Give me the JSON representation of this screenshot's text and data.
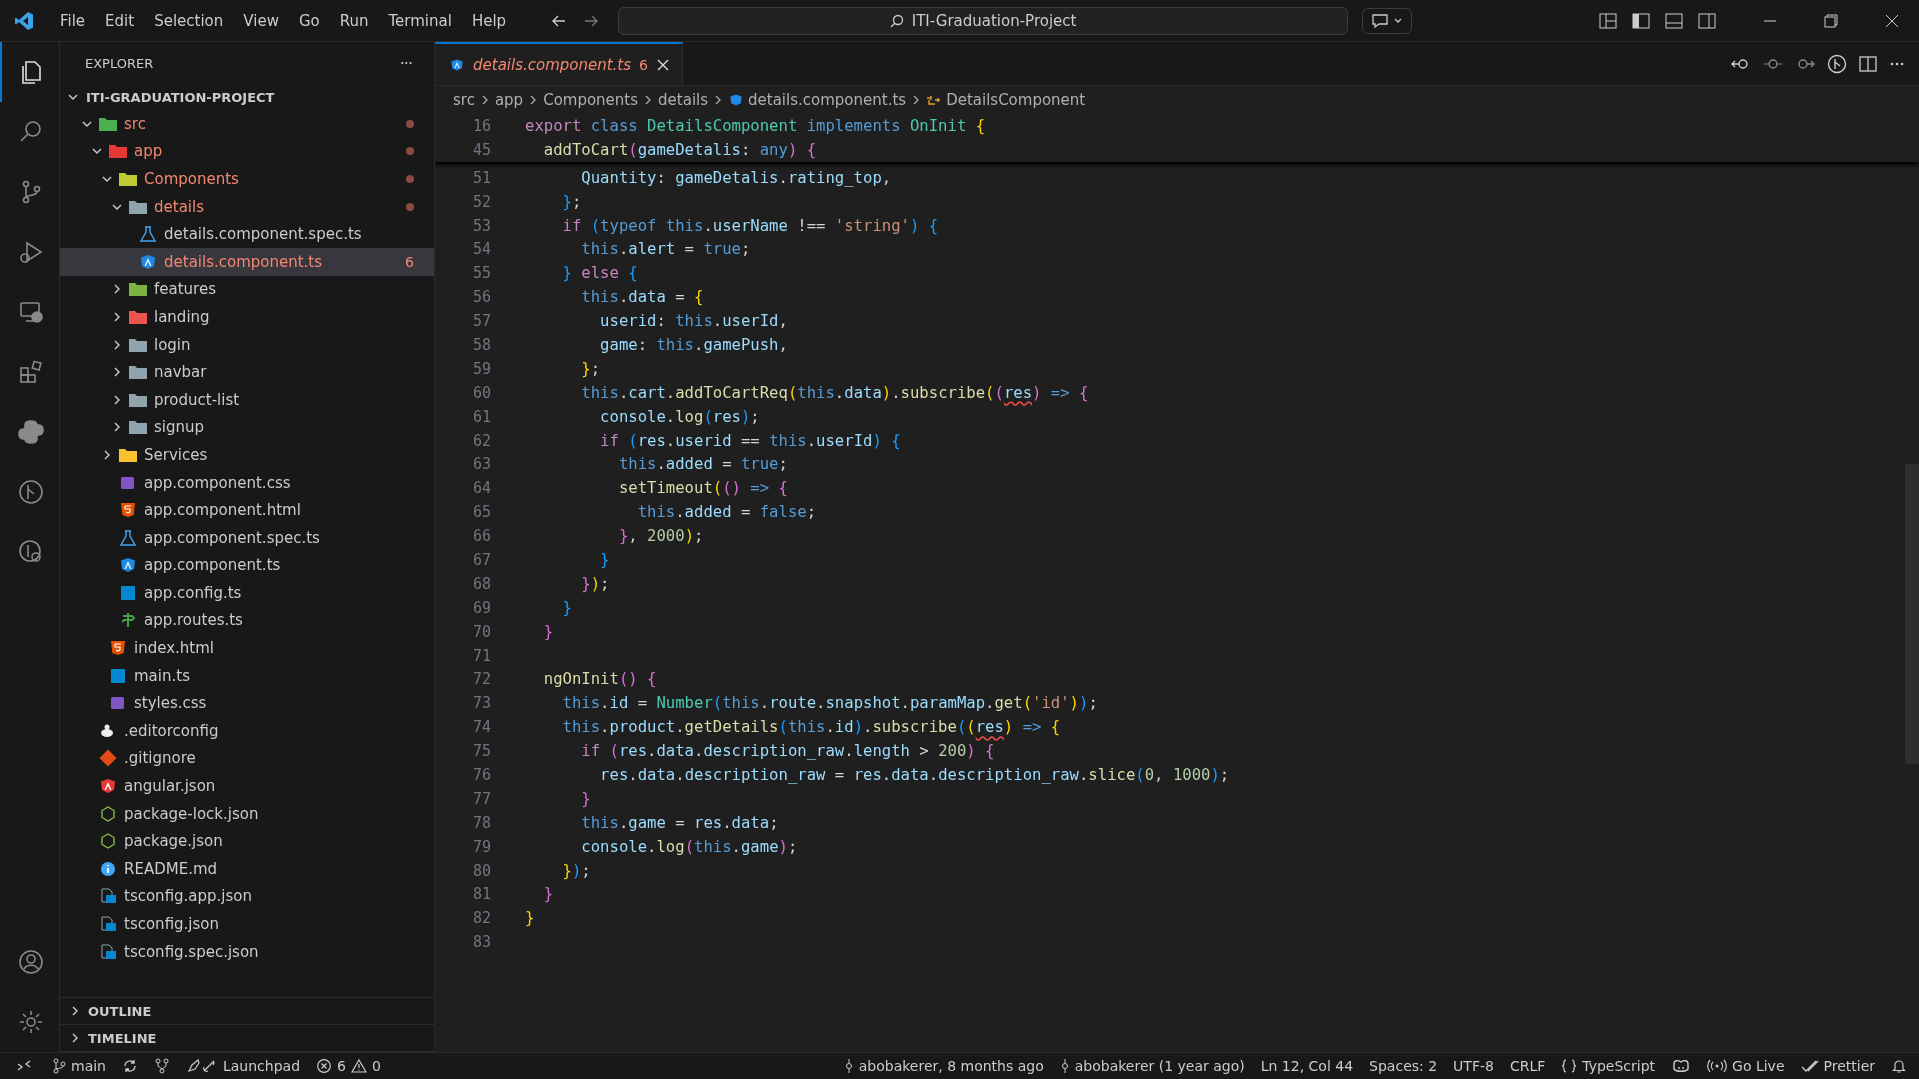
{
  "title_bar": {
    "menu": [
      "File",
      "Edit",
      "Selection",
      "View",
      "Go",
      "Run",
      "Terminal",
      "Help"
    ],
    "command_center": "ITI-Graduation-Project"
  },
  "activity_bar": {
    "top": [
      {
        "kind": "files",
        "selected": true
      },
      {
        "kind": "search",
        "selected": false
      },
      {
        "kind": "branch",
        "selected": false
      },
      {
        "kind": "debug",
        "selected": false
      },
      {
        "kind": "remote",
        "selected": false
      },
      {
        "kind": "extensions",
        "selected": false
      },
      {
        "kind": "python",
        "selected": false
      },
      {
        "kind": "graph",
        "selected": false
      },
      {
        "kind": "history",
        "selected": false
      }
    ],
    "bottom": [
      {
        "kind": "account"
      },
      {
        "kind": "settings"
      }
    ]
  },
  "sidebar": {
    "title": "EXPLORER",
    "more": "···",
    "root": "ITI-GRADUATION-PROJECT",
    "tree": [
      {
        "name": "src",
        "kind": "folder",
        "color": "#4caf50",
        "expanded": true,
        "has_errors": true,
        "selected": false,
        "children": [
          {
            "name": "app",
            "kind": "folder",
            "color": "#e53935",
            "expanded": true,
            "has_errors": true,
            "selected": false,
            "children": [
              {
                "name": "Components",
                "kind": "folder",
                "color": "#c0ca33",
                "expanded": true,
                "has_errors": true,
                "selected": false,
                "children": [
                  {
                    "name": "details",
                    "kind": "folder",
                    "color": "#90a4ae",
                    "expanded": true,
                    "has_errors": true,
                    "selected": false,
                    "children": [
                      {
                        "name": "details.component.spec.ts",
                        "kind": "spec",
                        "has_errors": false,
                        "selected": false
                      },
                      {
                        "name": "details.component.ts",
                        "kind": "angular",
                        "has_errors": true,
                        "badge": "6",
                        "selected": true
                      }
                    ]
                  },
                  {
                    "name": "features",
                    "kind": "folder",
                    "color": "#7cb342",
                    "expanded": false,
                    "has_errors": false,
                    "selected": false
                  },
                  {
                    "name": "landing",
                    "kind": "folder",
                    "color": "#ef5350",
                    "expanded": false,
                    "has_errors": false,
                    "selected": false
                  },
                  {
                    "name": "login",
                    "kind": "folder",
                    "color": "#90a4ae",
                    "expanded": false,
                    "has_errors": false,
                    "selected": false
                  },
                  {
                    "name": "navbar",
                    "kind": "folder",
                    "color": "#90a4ae",
                    "expanded": false,
                    "has_errors": false,
                    "selected": false
                  },
                  {
                    "name": "product-list",
                    "kind": "folder",
                    "color": "#90a4ae",
                    "expanded": false,
                    "has_errors": false,
                    "selected": false
                  },
                  {
                    "name": "signup",
                    "kind": "folder",
                    "color": "#90a4ae",
                    "expanded": false,
                    "has_errors": false,
                    "selected": false
                  }
                ]
              },
              {
                "name": "Services",
                "kind": "folder",
                "color": "#fbc02d",
                "expanded": false,
                "has_errors": false,
                "selected": false
              },
              {
                "name": "app.component.css",
                "kind": "css",
                "has_errors": false,
                "selected": false
              },
              {
                "name": "app.component.html",
                "kind": "html",
                "has_errors": false,
                "selected": false
              },
              {
                "name": "app.component.spec.ts",
                "kind": "spec",
                "has_errors": false,
                "selected": false
              },
              {
                "name": "app.component.ts",
                "kind": "angular",
                "has_errors": false,
                "selected": false
              },
              {
                "name": "app.config.ts",
                "kind": "ts",
                "has_errors": false,
                "selected": false
              },
              {
                "name": "app.routes.ts",
                "kind": "routes",
                "has_errors": false,
                "selected": false
              }
            ]
          },
          {
            "name": "index.html",
            "kind": "html",
            "has_errors": false,
            "selected": false
          },
          {
            "name": "main.ts",
            "kind": "ts",
            "has_errors": false,
            "selected": false
          },
          {
            "name": "styles.css",
            "kind": "css",
            "has_errors": false,
            "selected": false
          }
        ]
      },
      {
        "name": ".editorconfig",
        "kind": "config",
        "has_errors": false,
        "selected": false
      },
      {
        "name": ".gitignore",
        "kind": "git",
        "has_errors": false,
        "selected": false
      },
      {
        "name": "angular.json",
        "kind": "angular-json",
        "has_errors": false,
        "selected": false
      },
      {
        "name": "package-lock.json",
        "kind": "npm",
        "has_errors": false,
        "selected": false
      },
      {
        "name": "package.json",
        "kind": "npm",
        "has_errors": false,
        "selected": false
      },
      {
        "name": "README.md",
        "kind": "info",
        "has_errors": false,
        "selected": false
      },
      {
        "name": "tsconfig.app.json",
        "kind": "tsconfig",
        "has_errors": false,
        "selected": false
      },
      {
        "name": "tsconfig.json",
        "kind": "tsconfig",
        "has_errors": false,
        "selected": false
      },
      {
        "name": "tsconfig.spec.json",
        "kind": "tsconfig",
        "has_errors": false,
        "selected": false
      }
    ],
    "sections": [
      "OUTLINE",
      "TIMELINE"
    ]
  },
  "tabs": [
    {
      "label": "details.component.ts",
      "badge": "6",
      "selected": true
    }
  ],
  "breadcrumbs": [
    "src",
    "app",
    "Components",
    "details",
    "details.component.ts",
    "DetailsComponent"
  ],
  "sticky_lines": [
    {
      "number": "16",
      "tokens": [
        {
          "kind": "keyword",
          "text": "export "
        },
        {
          "kind": "storage",
          "text": "class "
        },
        {
          "kind": "type",
          "text": "DetailsComponent "
        },
        {
          "kind": "storage",
          "text": "implements "
        },
        {
          "kind": "type",
          "text": "OnInit "
        },
        {
          "kind": "bracket1",
          "text": "{"
        }
      ]
    },
    {
      "number": "45",
      "tokens": [
        {
          "kind": "function",
          "text": "  addToCart"
        },
        {
          "kind": "bracket2",
          "text": "("
        },
        {
          "kind": "variable",
          "text": "gameDetalis"
        },
        {
          "kind": "plain",
          "text": ": "
        },
        {
          "kind": "storage",
          "text": "any"
        },
        {
          "kind": "bracket2",
          "text": ")"
        },
        {
          "kind": "bracket2",
          "text": " {"
        }
      ]
    }
  ],
  "lines": [
    {
      "number": "51",
      "tokens": [
        {
          "kind": "variable",
          "text": "      Quantity"
        },
        {
          "kind": "plain",
          "text": ": "
        },
        {
          "kind": "variable",
          "text": "gameDetalis"
        },
        {
          "kind": "plain",
          "text": "."
        },
        {
          "kind": "variable",
          "text": "rating_top"
        },
        {
          "kind": "plain",
          "text": ","
        }
      ]
    },
    {
      "number": "52",
      "tokens": [
        {
          "kind": "bracket3",
          "text": "    }"
        },
        {
          "kind": "plain",
          "text": ";"
        }
      ]
    },
    {
      "number": "53",
      "tokens": [
        {
          "kind": "keyword",
          "text": "    if "
        },
        {
          "kind": "bracket3",
          "text": "("
        },
        {
          "kind": "storage",
          "text": "typeof this"
        },
        {
          "kind": "plain",
          "text": "."
        },
        {
          "kind": "variable",
          "text": "userName"
        },
        {
          "kind": "plain",
          "text": " !== "
        },
        {
          "kind": "string",
          "text": "'string'"
        },
        {
          "kind": "bracket3",
          "text": ")"
        },
        {
          "kind": "bracket3",
          "text": " {"
        }
      ]
    },
    {
      "number": "54",
      "tokens": [
        {
          "kind": "storage",
          "text": "      this"
        },
        {
          "kind": "plain",
          "text": "."
        },
        {
          "kind": "variable",
          "text": "alert"
        },
        {
          "kind": "plain",
          "text": " = "
        },
        {
          "kind": "storage",
          "text": "true"
        },
        {
          "kind": "plain",
          "text": ";"
        }
      ]
    },
    {
      "number": "55",
      "tokens": [
        {
          "kind": "bracket3",
          "text": "    }"
        },
        {
          "kind": "keyword",
          "text": " else "
        },
        {
          "kind": "bracket3",
          "text": "{"
        }
      ]
    },
    {
      "number": "56",
      "tokens": [
        {
          "kind": "storage",
          "text": "      this"
        },
        {
          "kind": "plain",
          "text": "."
        },
        {
          "kind": "variable",
          "text": "data"
        },
        {
          "kind": "plain",
          "text": " = "
        },
        {
          "kind": "bracket1",
          "text": "{"
        }
      ]
    },
    {
      "number": "57",
      "tokens": [
        {
          "kind": "variable",
          "text": "        userid"
        },
        {
          "kind": "plain",
          "text": ": "
        },
        {
          "kind": "storage",
          "text": "this"
        },
        {
          "kind": "plain",
          "text": "."
        },
        {
          "kind": "variable",
          "text": "userId"
        },
        {
          "kind": "plain",
          "text": ","
        }
      ]
    },
    {
      "number": "58",
      "tokens": [
        {
          "kind": "variable",
          "text": "        game"
        },
        {
          "kind": "plain",
          "text": ": "
        },
        {
          "kind": "storage",
          "text": "this"
        },
        {
          "kind": "plain",
          "text": "."
        },
        {
          "kind": "variable",
          "text": "gamePush"
        },
        {
          "kind": "plain",
          "text": ","
        }
      ]
    },
    {
      "number": "59",
      "tokens": [
        {
          "kind": "bracket1",
          "text": "      }"
        },
        {
          "kind": "plain",
          "text": ";"
        }
      ]
    },
    {
      "number": "60",
      "tokens": [
        {
          "kind": "storage",
          "text": "      this"
        },
        {
          "kind": "plain",
          "text": "."
        },
        {
          "kind": "variable",
          "text": "cart"
        },
        {
          "kind": "plain",
          "text": "."
        },
        {
          "kind": "function",
          "text": "addToCartReq"
        },
        {
          "kind": "bracket1",
          "text": "("
        },
        {
          "kind": "storage",
          "text": "this"
        },
        {
          "kind": "plain",
          "text": "."
        },
        {
          "kind": "variable",
          "text": "data"
        },
        {
          "kind": "bracket1",
          "text": ")"
        },
        {
          "kind": "plain",
          "text": "."
        },
        {
          "kind": "function",
          "text": "subscribe"
        },
        {
          "kind": "bracket1",
          "text": "("
        },
        {
          "kind": "bracket2",
          "text": "("
        },
        {
          "kind": "error",
          "text": "res"
        },
        {
          "kind": "bracket2",
          "text": ")"
        },
        {
          "kind": "storage",
          "text": " => "
        },
        {
          "kind": "bracket2",
          "text": "{"
        }
      ]
    },
    {
      "number": "61",
      "tokens": [
        {
          "kind": "variable",
          "text": "        console"
        },
        {
          "kind": "plain",
          "text": "."
        },
        {
          "kind": "function",
          "text": "log"
        },
        {
          "kind": "bracket3",
          "text": "("
        },
        {
          "kind": "variable",
          "text": "res"
        },
        {
          "kind": "bracket3",
          "text": ")"
        },
        {
          "kind": "plain",
          "text": ";"
        }
      ]
    },
    {
      "number": "62",
      "tokens": [
        {
          "kind": "keyword",
          "text": "        if "
        },
        {
          "kind": "bracket3",
          "text": "("
        },
        {
          "kind": "variable",
          "text": "res"
        },
        {
          "kind": "plain",
          "text": "."
        },
        {
          "kind": "variable",
          "text": "userid"
        },
        {
          "kind": "plain",
          "text": " == "
        },
        {
          "kind": "storage",
          "text": "this"
        },
        {
          "kind": "plain",
          "text": "."
        },
        {
          "kind": "variable",
          "text": "userId"
        },
        {
          "kind": "bracket3",
          "text": ")"
        },
        {
          "kind": "bracket3",
          "text": " {"
        }
      ]
    },
    {
      "number": "63",
      "tokens": [
        {
          "kind": "storage",
          "text": "          this"
        },
        {
          "kind": "plain",
          "text": "."
        },
        {
          "kind": "variable",
          "text": "added"
        },
        {
          "kind": "plain",
          "text": " = "
        },
        {
          "kind": "storage",
          "text": "true"
        },
        {
          "kind": "plain",
          "text": ";"
        }
      ]
    },
    {
      "number": "64",
      "tokens": [
        {
          "kind": "function",
          "text": "          setTimeout"
        },
        {
          "kind": "bracket1",
          "text": "("
        },
        {
          "kind": "bracket2",
          "text": "()"
        },
        {
          "kind": "storage",
          "text": " => "
        },
        {
          "kind": "bracket2",
          "text": "{"
        }
      ]
    },
    {
      "number": "65",
      "tokens": [
        {
          "kind": "storage",
          "text": "            this"
        },
        {
          "kind": "plain",
          "text": "."
        },
        {
          "kind": "variable",
          "text": "added"
        },
        {
          "kind": "plain",
          "text": " = "
        },
        {
          "kind": "storage",
          "text": "false"
        },
        {
          "kind": "plain",
          "text": ";"
        }
      ]
    },
    {
      "number": "66",
      "tokens": [
        {
          "kind": "bracket2",
          "text": "          }"
        },
        {
          "kind": "plain",
          "text": ", "
        },
        {
          "kind": "number",
          "text": "2000"
        },
        {
          "kind": "bracket1",
          "text": ")"
        },
        {
          "kind": "plain",
          "text": ";"
        }
      ]
    },
    {
      "number": "67",
      "tokens": [
        {
          "kind": "bracket3",
          "text": "        }"
        }
      ]
    },
    {
      "number": "68",
      "tokens": [
        {
          "kind": "bracket2",
          "text": "      }"
        },
        {
          "kind": "bracket1",
          "text": ")"
        },
        {
          "kind": "plain",
          "text": ";"
        }
      ]
    },
    {
      "number": "69",
      "tokens": [
        {
          "kind": "bracket3",
          "text": "    }"
        }
      ]
    },
    {
      "number": "70",
      "tokens": [
        {
          "kind": "bracket2",
          "text": "  }"
        }
      ]
    },
    {
      "number": "71"
    },
    {
      "number": "72",
      "tokens": [
        {
          "kind": "function",
          "text": "  ngOnInit"
        },
        {
          "kind": "bracket2",
          "text": "()"
        },
        {
          "kind": "bracket2",
          "text": " {"
        }
      ]
    },
    {
      "number": "73",
      "tokens": [
        {
          "kind": "storage",
          "text": "    this"
        },
        {
          "kind": "plain",
          "text": "."
        },
        {
          "kind": "variable",
          "text": "id"
        },
        {
          "kind": "plain",
          "text": " = "
        },
        {
          "kind": "type",
          "text": "Number"
        },
        {
          "kind": "bracket3",
          "text": "("
        },
        {
          "kind": "storage",
          "text": "this"
        },
        {
          "kind": "plain",
          "text": "."
        },
        {
          "kind": "variable",
          "text": "route"
        },
        {
          "kind": "plain",
          "text": "."
        },
        {
          "kind": "variable",
          "text": "snapshot"
        },
        {
          "kind": "plain",
          "text": "."
        },
        {
          "kind": "variable",
          "text": "paramMap"
        },
        {
          "kind": "plain",
          "text": "."
        },
        {
          "kind": "function",
          "text": "get"
        },
        {
          "kind": "bracket1",
          "text": "("
        },
        {
          "kind": "string",
          "text": "'id'"
        },
        {
          "kind": "bracket1",
          "text": ")"
        },
        {
          "kind": "bracket3",
          "text": ")"
        },
        {
          "kind": "plain",
          "text": ";"
        }
      ]
    },
    {
      "number": "74",
      "tokens": [
        {
          "kind": "storage",
          "text": "    this"
        },
        {
          "kind": "plain",
          "text": "."
        },
        {
          "kind": "variable",
          "text": "product"
        },
        {
          "kind": "plain",
          "text": "."
        },
        {
          "kind": "function",
          "text": "getDetails"
        },
        {
          "kind": "bracket3",
          "text": "("
        },
        {
          "kind": "storage",
          "text": "this"
        },
        {
          "kind": "plain",
          "text": "."
        },
        {
          "kind": "variable",
          "text": "id"
        },
        {
          "kind": "bracket3",
          "text": ")"
        },
        {
          "kind": "plain",
          "text": "."
        },
        {
          "kind": "function",
          "text": "subscribe"
        },
        {
          "kind": "bracket3",
          "text": "("
        },
        {
          "kind": "bracket1",
          "text": "("
        },
        {
          "kind": "error",
          "text": "res"
        },
        {
          "kind": "bracket1",
          "text": ")"
        },
        {
          "kind": "storage",
          "text": " => "
        },
        {
          "kind": "bracket1",
          "text": "{"
        }
      ]
    },
    {
      "number": "75",
      "tokens": [
        {
          "kind": "keyword",
          "text": "      if "
        },
        {
          "kind": "bracket2",
          "text": "("
        },
        {
          "kind": "variable",
          "text": "res"
        },
        {
          "kind": "plain",
          "text": "."
        },
        {
          "kind": "variable",
          "text": "data"
        },
        {
          "kind": "plain",
          "text": "."
        },
        {
          "kind": "variable",
          "text": "description_raw"
        },
        {
          "kind": "plain",
          "text": "."
        },
        {
          "kind": "variable",
          "text": "length"
        },
        {
          "kind": "plain",
          "text": " > "
        },
        {
          "kind": "number",
          "text": "200"
        },
        {
          "kind": "bracket2",
          "text": ")"
        },
        {
          "kind": "bracket2",
          "text": " {"
        }
      ]
    },
    {
      "number": "76",
      "tokens": [
        {
          "kind": "variable",
          "text": "        res"
        },
        {
          "kind": "plain",
          "text": "."
        },
        {
          "kind": "variable",
          "text": "data"
        },
        {
          "kind": "plain",
          "text": "."
        },
        {
          "kind": "variable",
          "text": "description_raw"
        },
        {
          "kind": "plain",
          "text": " = "
        },
        {
          "kind": "variable",
          "text": "res"
        },
        {
          "kind": "plain",
          "text": "."
        },
        {
          "kind": "variable",
          "text": "data"
        },
        {
          "kind": "plain",
          "text": "."
        },
        {
          "kind": "variable",
          "text": "description_raw"
        },
        {
          "kind": "plain",
          "text": "."
        },
        {
          "kind": "function",
          "text": "slice"
        },
        {
          "kind": "bracket3",
          "text": "("
        },
        {
          "kind": "number",
          "text": "0"
        },
        {
          "kind": "plain",
          "text": ", "
        },
        {
          "kind": "number",
          "text": "1000"
        },
        {
          "kind": "bracket3",
          "text": ")"
        },
        {
          "kind": "plain",
          "text": ";"
        }
      ]
    },
    {
      "number": "77",
      "tokens": [
        {
          "kind": "bracket2",
          "text": "      }"
        }
      ]
    },
    {
      "number": "78",
      "tokens": [
        {
          "kind": "storage",
          "text": "      this"
        },
        {
          "kind": "plain",
          "text": "."
        },
        {
          "kind": "variable",
          "text": "game"
        },
        {
          "kind": "plain",
          "text": " = "
        },
        {
          "kind": "variable",
          "text": "res"
        },
        {
          "kind": "plain",
          "text": "."
        },
        {
          "kind": "variable",
          "text": "data"
        },
        {
          "kind": "plain",
          "text": ";"
        }
      ]
    },
    {
      "number": "79",
      "tokens": [
        {
          "kind": "variable",
          "text": "      console"
        },
        {
          "kind": "plain",
          "text": "."
        },
        {
          "kind": "function",
          "text": "log"
        },
        {
          "kind": "bracket2",
          "text": "("
        },
        {
          "kind": "storage",
          "text": "this"
        },
        {
          "kind": "plain",
          "text": "."
        },
        {
          "kind": "variable",
          "text": "game"
        },
        {
          "kind": "bracket2",
          "text": ")"
        },
        {
          "kind": "plain",
          "text": ";"
        }
      ]
    },
    {
      "number": "80",
      "tokens": [
        {
          "kind": "bracket1",
          "text": "    }"
        },
        {
          "kind": "bracket3",
          "text": ")"
        },
        {
          "kind": "plain",
          "text": ";"
        }
      ]
    },
    {
      "number": "81",
      "tokens": [
        {
          "kind": "bracket2",
          "text": "  }"
        }
      ]
    },
    {
      "number": "82",
      "tokens": [
        {
          "kind": "bracket1",
          "text": "}"
        }
      ]
    },
    {
      "number": "83"
    }
  ],
  "status_bar": {
    "left": [
      {
        "kind": "remote"
      },
      {
        "kind": "branch",
        "text": "main"
      },
      {
        "kind": "sync"
      },
      {
        "kind": "graph"
      },
      {
        "kind": "launchpad",
        "text": "Launchpad"
      },
      {
        "kind": "problems",
        "errors": "6",
        "warnings": "0"
      }
    ],
    "right": [
      {
        "kind": "blame",
        "text": "abobakerer, 8 months ago"
      },
      {
        "kind": "blame",
        "text": "abobakerer (1 year ago)"
      },
      {
        "kind": "text",
        "text": "Ln 12, Col 44"
      },
      {
        "kind": "text",
        "text": "Spaces: 2"
      },
      {
        "kind": "text",
        "text": "UTF-8"
      },
      {
        "kind": "text",
        "text": "CRLF"
      },
      {
        "kind": "language",
        "text": "TypeScript"
      },
      {
        "kind": "copilot"
      },
      {
        "kind": "golive",
        "text": "Go Live"
      },
      {
        "kind": "prettier",
        "text": "Prettier"
      },
      {
        "kind": "bell"
      }
    ]
  }
}
